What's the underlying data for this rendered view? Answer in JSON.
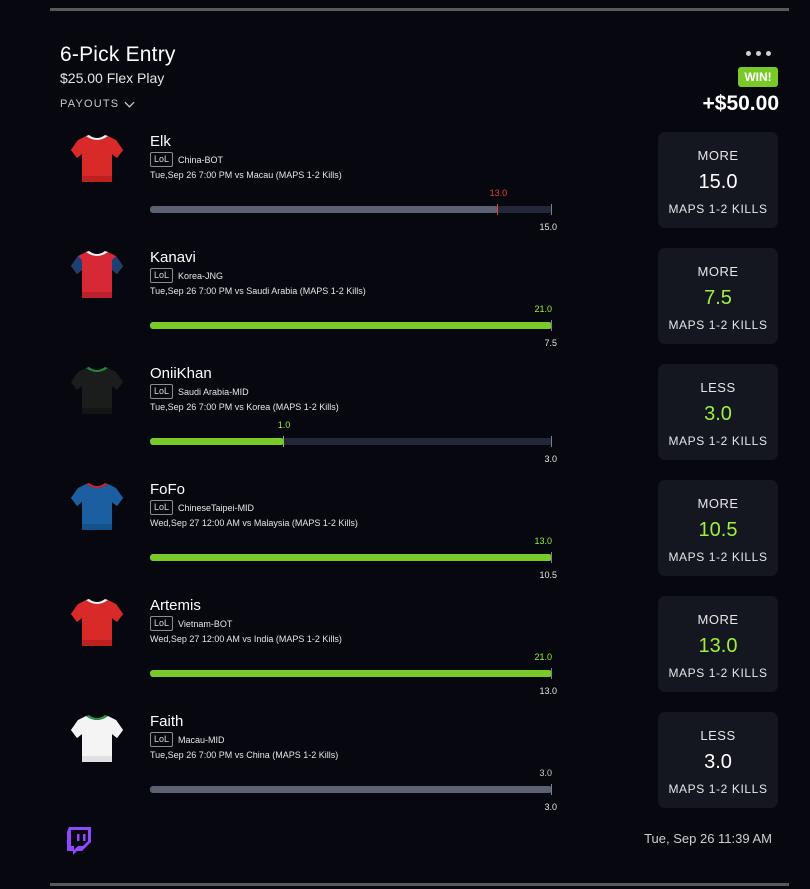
{
  "entry": {
    "title": "6-Pick Entry",
    "subtitle": "$25.00 Flex Play",
    "payouts_label": "PAYOUTS",
    "result_badge": "WIN!",
    "payout_amount": "+$50.00",
    "timestamp": "Tue, Sep 26 11:39 AM"
  },
  "colors": {
    "win_green": "#79c928",
    "hit_text": "#9ef03c",
    "miss_red": "#e0443a",
    "bar_grey": "#5b6170",
    "bar_track": "#222838",
    "card_bg": "#141720"
  },
  "picks": [
    {
      "player": "Elk",
      "league": "LoL",
      "team": "China-BOT",
      "game": "Tue,Sep 26 7:00 PM  vs Macau (MAPS 1-2 Kills)",
      "direction": "MORE",
      "line": "15.0",
      "stat": "MAPS 1-2 KILLS",
      "actual": "13.0",
      "actual_value": 13.0,
      "line_value": 15.0,
      "bar_max": 15.0,
      "result": "miss",
      "jersey": "red-jersey-icon"
    },
    {
      "player": "Kanavi",
      "league": "LoL",
      "team": "Korea-JNG",
      "game": "Tue,Sep 26 7:00 PM  vs Saudi Arabia (MAPS 1-2 Kills)",
      "direction": "MORE",
      "line": "7.5",
      "stat": "MAPS 1-2 KILLS",
      "actual": "21.0",
      "actual_value": 21.0,
      "line_value": 7.5,
      "bar_max": 21.0,
      "result": "hit",
      "jersey": "red-navy-jersey-icon"
    },
    {
      "player": "OniiKhan",
      "league": "LoL",
      "team": "Saudi Arabia-MID",
      "game": "Tue,Sep 26 7:00 PM  vs Korea (MAPS 1-2 Kills)",
      "direction": "LESS",
      "line": "3.0",
      "stat": "MAPS 1-2 KILLS",
      "actual": "1.0",
      "actual_value": 1.0,
      "line_value": 3.0,
      "bar_max": 3.0,
      "result": "hit",
      "jersey": "black-green-jersey-icon"
    },
    {
      "player": "FoFo",
      "league": "LoL",
      "team": "ChineseTaipei-MID",
      "game": "Wed,Sep 27 12:00 AM  vs Malaysia (MAPS 1-2 Kills)",
      "direction": "MORE",
      "line": "10.5",
      "stat": "MAPS 1-2 KILLS",
      "actual": "13.0",
      "actual_value": 13.0,
      "line_value": 10.5,
      "bar_max": 13.0,
      "result": "hit",
      "jersey": "blue-jersey-icon"
    },
    {
      "player": "Artemis",
      "league": "LoL",
      "team": "Vietnam-BOT",
      "game": "Wed,Sep 27 12:00 AM  vs India (MAPS 1-2 Kills)",
      "direction": "MORE",
      "line": "13.0",
      "stat": "MAPS 1-2 KILLS",
      "actual": "21.0",
      "actual_value": 21.0,
      "line_value": 13.0,
      "bar_max": 21.0,
      "result": "hit",
      "jersey": "red-jersey-icon"
    },
    {
      "player": "Faith",
      "league": "LoL",
      "team": "Macau-MID",
      "game": "Tue,Sep 26 7:00 PM  vs China (MAPS 1-2 Kills)",
      "direction": "LESS",
      "line": "3.0",
      "stat": "MAPS 1-2 KILLS",
      "actual": "3.0",
      "actual_value": 3.0,
      "line_value": 3.0,
      "bar_max": 3.0,
      "result": "push",
      "jersey": "white-green-jersey-icon"
    }
  ]
}
